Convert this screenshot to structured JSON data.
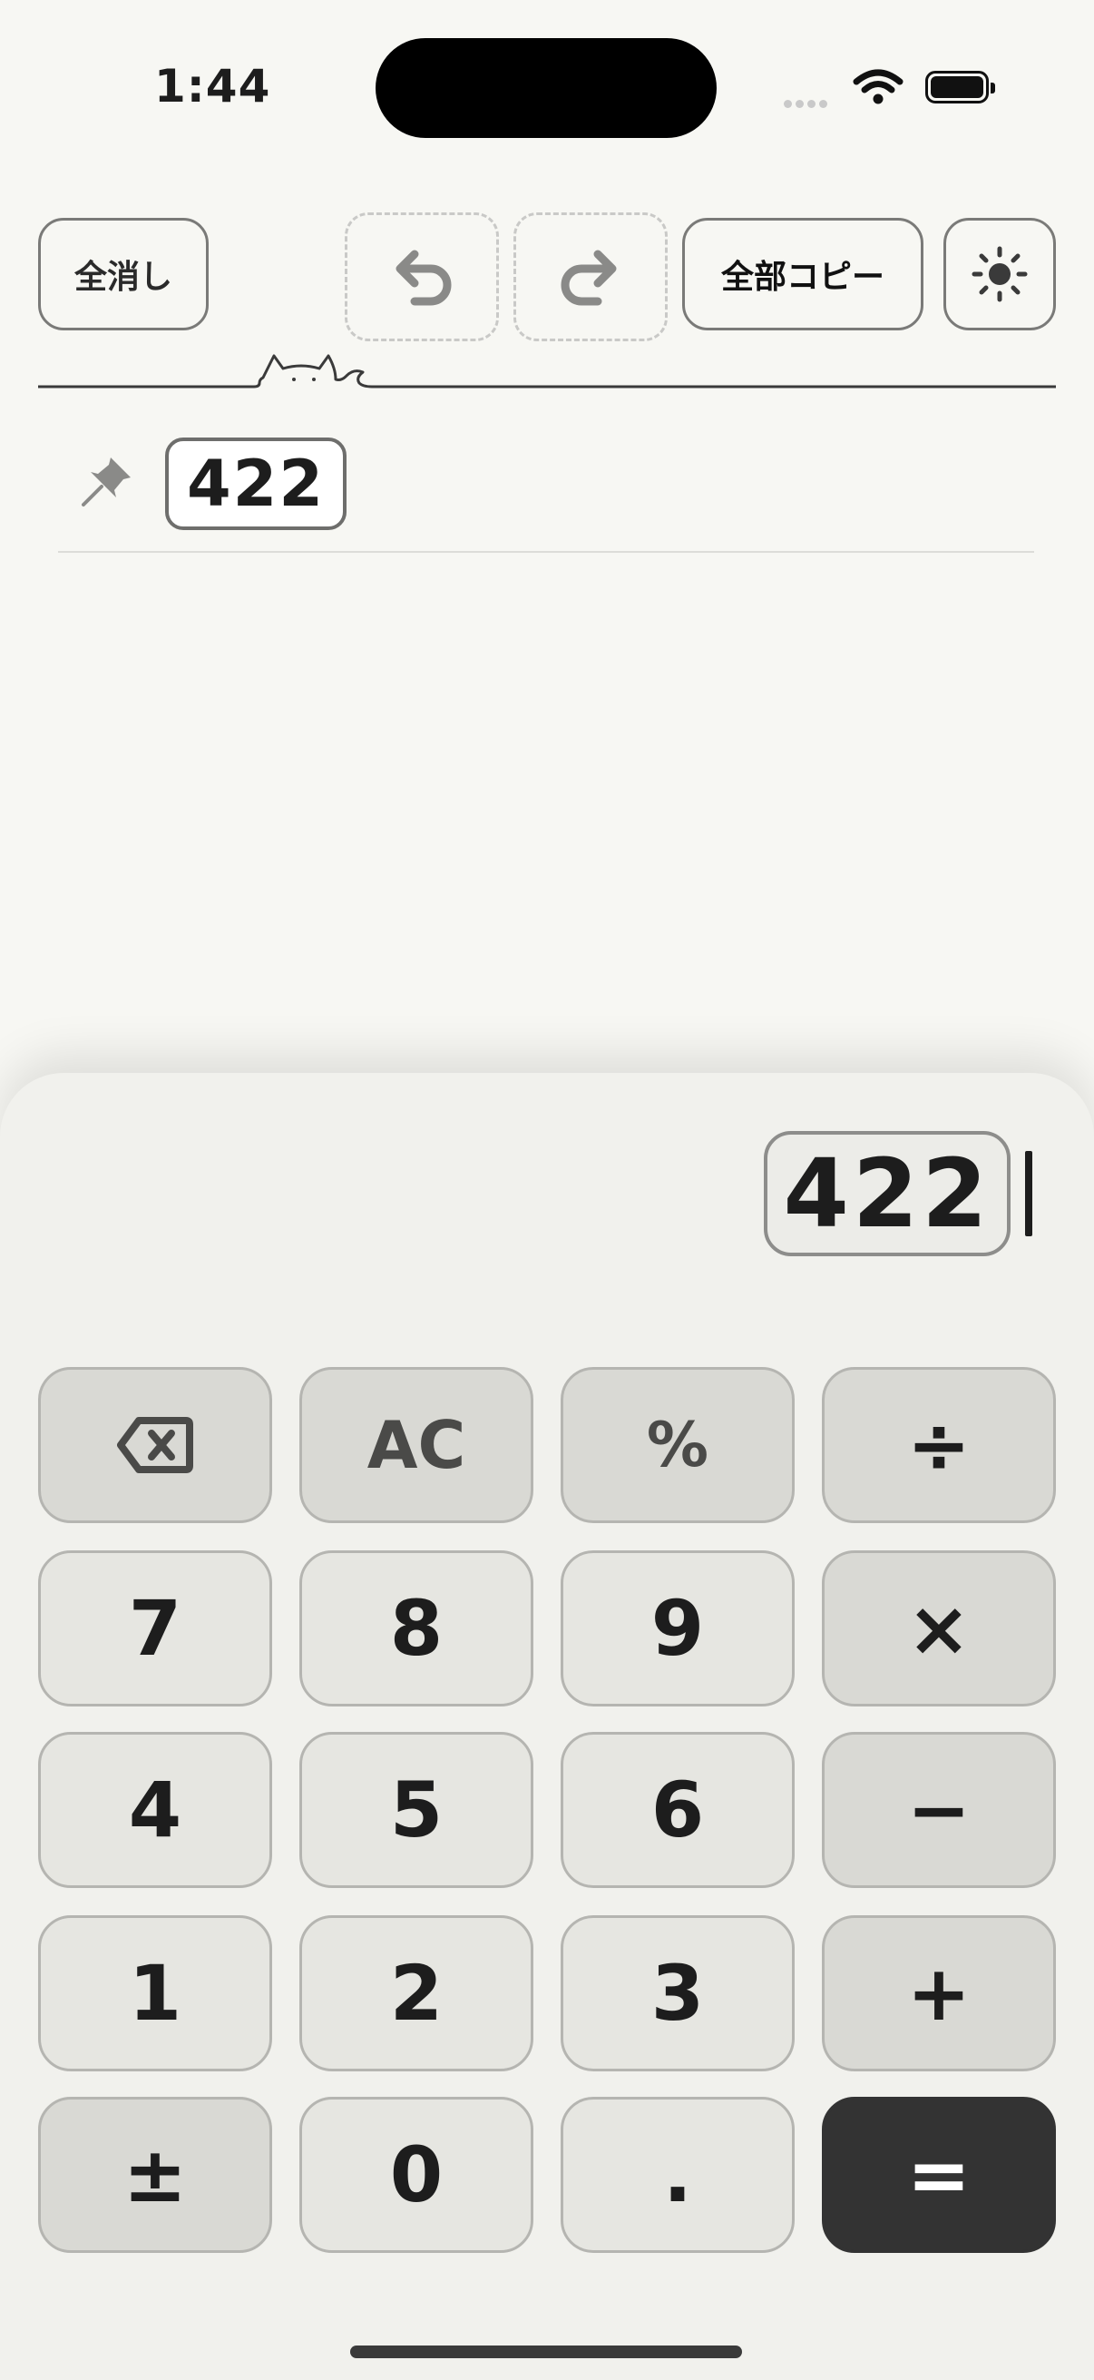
{
  "status_bar": {
    "time": "1:44",
    "icons": [
      "cellular-icon",
      "wifi-icon",
      "battery-icon"
    ]
  },
  "toolbar": {
    "clear_all_label": "全消し",
    "undo_icon": "undo-icon",
    "redo_icon": "redo-icon",
    "copy_all_label": "全部コピー",
    "theme_icon": "sun-icon"
  },
  "history": {
    "items": [
      {
        "pinned": true,
        "value": "422"
      }
    ]
  },
  "calculator": {
    "display_value": "422",
    "keys": {
      "backspace": "backspace-icon",
      "ac": "AC",
      "percent": "%",
      "divide": "÷",
      "seven": "7",
      "eight": "8",
      "nine": "9",
      "multiply": "×",
      "four": "4",
      "five": "5",
      "six": "6",
      "minus": "−",
      "one": "1",
      "two": "2",
      "three": "3",
      "plus": "+",
      "plus_minus": "±",
      "zero": "0",
      "decimal": ".",
      "equals": "="
    }
  },
  "colors": {
    "background": "#f7f7f3",
    "panel": "#f1f1ed",
    "key": "#e6e6e1",
    "operator_key": "#d9d9d4",
    "equals_key": "#333333"
  }
}
